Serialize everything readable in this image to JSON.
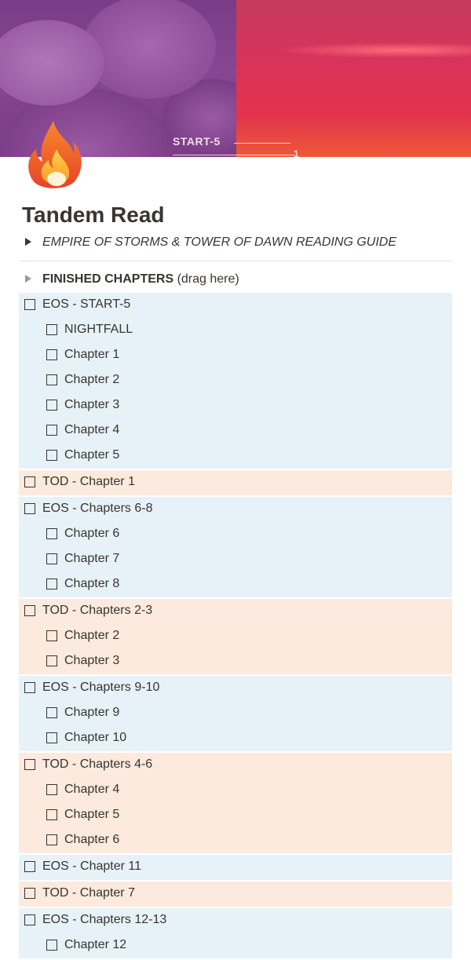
{
  "cover": {
    "text": "START-5",
    "number": "1"
  },
  "page": {
    "icon": "fire-emoji-icon",
    "title": "Tandem Read"
  },
  "guide_toggle": {
    "label": "EMPIRE OF STORMS & TOWER OF DAWN READING GUIDE"
  },
  "finished_toggle": {
    "label_bold": "FINISHED CHAPTERS",
    "label_rest": " (drag here)"
  },
  "colors": {
    "eos_background": "#e7f1f8",
    "tod_background": "#fbeadd",
    "text": "#37352f"
  },
  "groups": [
    {
      "type": "eos",
      "title": "EOS - START-5",
      "items": [
        "NIGHTFALL",
        "Chapter 1",
        "Chapter 2",
        "Chapter 3",
        "Chapter 4",
        "Chapter 5"
      ]
    },
    {
      "type": "tod",
      "title": "TOD - Chapter 1",
      "items": []
    },
    {
      "type": "eos",
      "title": "EOS - Chapters 6-8",
      "items": [
        "Chapter 6",
        "Chapter 7",
        "Chapter 8"
      ]
    },
    {
      "type": "tod",
      "title": "TOD - Chapters 2-3",
      "items": [
        "Chapter 2",
        "Chapter 3"
      ]
    },
    {
      "type": "eos",
      "title": "EOS - Chapters 9-10",
      "items": [
        "Chapter 9",
        "Chapter 10"
      ]
    },
    {
      "type": "tod",
      "title": "TOD - Chapters 4-6",
      "items": [
        "Chapter 4",
        "Chapter 5",
        "Chapter 6"
      ]
    },
    {
      "type": "eos",
      "title": "EOS - Chapter 11",
      "items": []
    },
    {
      "type": "tod",
      "title": "TOD - Chapter 7",
      "items": []
    },
    {
      "type": "eos",
      "title": "EOS - Chapters 12-13",
      "items": [
        "Chapter 12"
      ]
    }
  ]
}
